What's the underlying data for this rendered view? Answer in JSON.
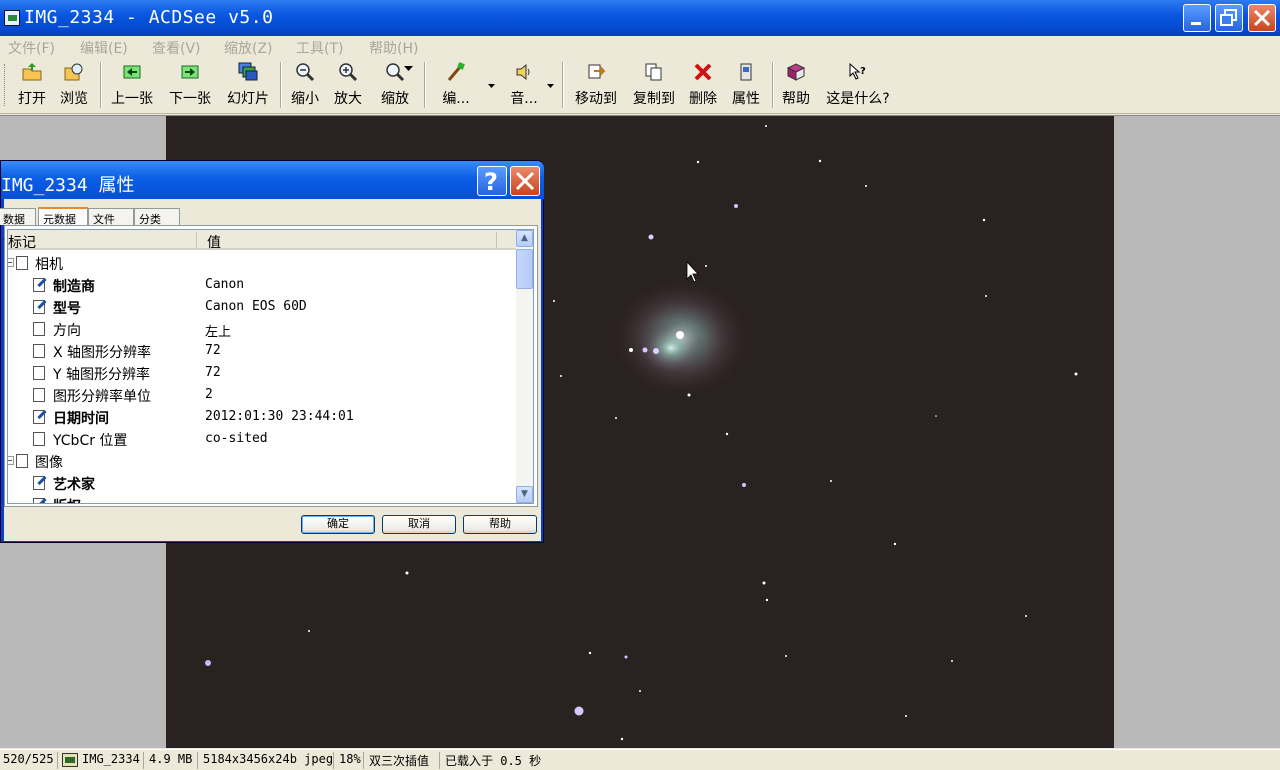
{
  "app": {
    "title": "IMG_2334 - ACDSee v5.0"
  },
  "menu": [
    "文件(F)",
    "编辑(E)",
    "查看(V)",
    "缩放(Z)",
    "工具(T)",
    "帮助(H)"
  ],
  "toolbar": {
    "open": "打开",
    "browse": "浏览",
    "prev": "上一张",
    "next": "下一张",
    "slideshow": "幻灯片",
    "zoom_out": "缩小",
    "zoom_in": "放大",
    "zoom": "缩放",
    "edit": "编...",
    "audio": "音...",
    "move_to": "移动到",
    "copy_to": "复制到",
    "delete": "删除",
    "properties": "属性",
    "help": "帮助",
    "whats_this": "这是什么?"
  },
  "dialog": {
    "title": "IMG_2334 属性",
    "tabs": [
      "数据库",
      "元数据",
      "文件",
      "分类"
    ],
    "active_tab": "元数据",
    "col_tag": "标记",
    "col_value": "值",
    "rows": [
      {
        "label": "相机",
        "value": "",
        "bold": false,
        "group": true
      },
      {
        "label": "制造商",
        "value": "Canon",
        "bold": true
      },
      {
        "label": "型号",
        "value": "Canon EOS 60D",
        "bold": true
      },
      {
        "label": "方向",
        "value": "左上",
        "bold": false
      },
      {
        "label": "X 轴图形分辨率",
        "value": "72",
        "bold": false
      },
      {
        "label": "Y 轴图形分辨率",
        "value": "72",
        "bold": false
      },
      {
        "label": "图形分辨率单位",
        "value": "2",
        "bold": false
      },
      {
        "label": "日期时间",
        "value": "2012:01:30 23:44:01",
        "bold": true
      },
      {
        "label": "YCbCr 位置",
        "value": "co-sited",
        "bold": false
      },
      {
        "label": "图像",
        "value": "",
        "bold": false,
        "group": true
      },
      {
        "label": "艺术家",
        "value": "",
        "bold": true
      },
      {
        "label": "版权",
        "value": "",
        "bold": true
      }
    ],
    "ok": "确定",
    "cancel": "取消",
    "help": "帮助"
  },
  "status": {
    "position": "520/525",
    "file": "IMG_2334",
    "size": "4.9 MB",
    "dims": "5184x3456x24b jpeg",
    "zoom": "18%",
    "resample": "双三次插值",
    "load_time": "已载入于 0.5 秒"
  },
  "colors": {
    "titlebar": "#0a57e0",
    "photo_bg": "#2a2220",
    "viewer_bg": "#b9b9b9"
  }
}
